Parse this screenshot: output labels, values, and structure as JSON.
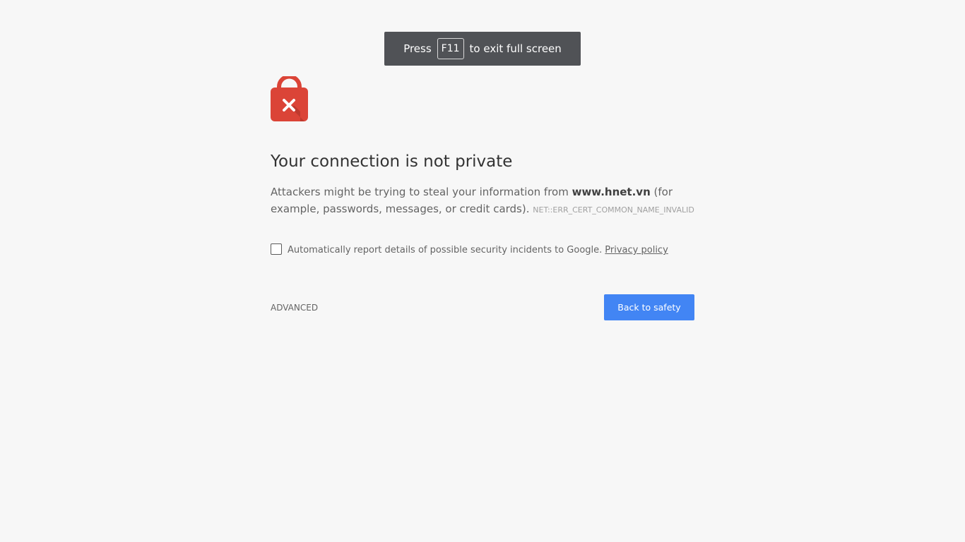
{
  "toast": {
    "prefix": "Press",
    "key": "F11",
    "suffix": "to exit full screen"
  },
  "icons": {
    "lock": "lock-error-icon",
    "lock_color": "#db4437"
  },
  "heading": "Your connection is not private",
  "message": {
    "before_domain": "Attackers might be trying to steal your information from ",
    "domain": "www.hnet.vn",
    "after_domain": " (for example, passwords, messages, or credit cards). ",
    "error_code": "NET::ERR_CERT_COMMON_NAME_INVALID"
  },
  "report": {
    "checked": false,
    "label": "Automatically report details of possible security incidents to Google.",
    "privacy_link": "Privacy policy"
  },
  "buttons": {
    "advanced": "ADVANCED",
    "back": "Back to safety"
  },
  "colors": {
    "primary": "#4285f4",
    "background": "#f7f7f7",
    "toast_bg": "#505256"
  }
}
